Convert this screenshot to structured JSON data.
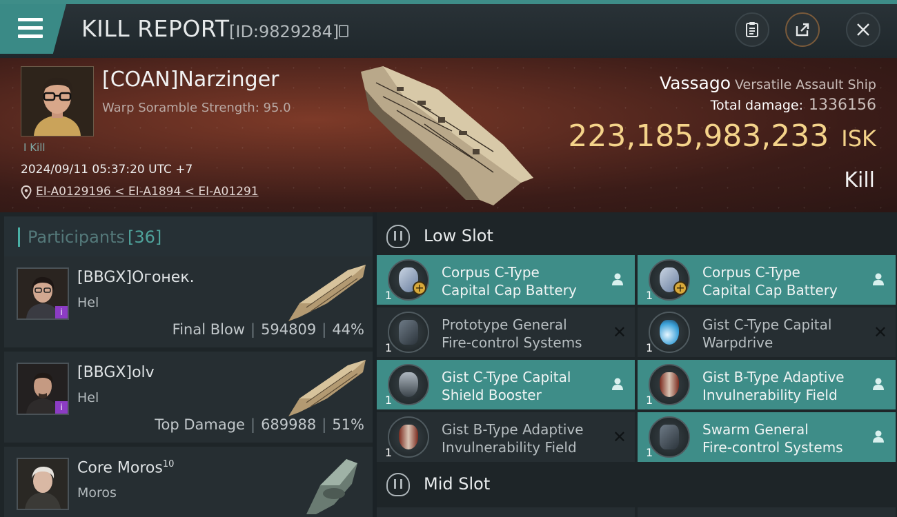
{
  "header": {
    "title": "KILL REPORT",
    "kill_id": "[ID:9829284]"
  },
  "victim": {
    "name": "[COAN]Narzinger",
    "scramble": "Warp Soramble Strength: 95.0",
    "kill_label": "I Kill",
    "timestamp": "2024/09/11 05:37:20 UTC +7",
    "location": "EI-A0129196 < EI-A1894 < EI-A01291"
  },
  "ship": {
    "name": "Vassago",
    "class": "Versatile Assault Ship",
    "total_damage_label": "Total damage:",
    "total_damage": "1336156",
    "isk_value": "223,185,983,233",
    "isk_unit": "ISK",
    "result": "Kill"
  },
  "participants": {
    "label": "Participants",
    "count": "[36]",
    "rows": [
      {
        "name": "[BBGX]Огонек.",
        "ship": "Hel",
        "role": "Final Blow",
        "damage": "594809",
        "percent": "44%",
        "badge": "i"
      },
      {
        "name": "[BBGX]olv",
        "ship": "Hel",
        "role": "Top Damage",
        "damage": "689988",
        "percent": "51%",
        "badge": "i"
      },
      {
        "name": "Core Moros",
        "level": "10",
        "ship": "Moros"
      }
    ]
  },
  "low_slot": {
    "label": "Low Slot",
    "modules": [
      {
        "line1": "Corpus C-Type",
        "line2": "Capital Cap Battery",
        "qty": "1",
        "status": "dropped",
        "icon": "cap-battery-icon"
      },
      {
        "line1": "Corpus C-Type",
        "line2": "Capital Cap Battery",
        "qty": "1",
        "status": "dropped",
        "icon": "cap-battery-icon"
      },
      {
        "line1": "Prototype General",
        "line2": "Fire-control Systems",
        "qty": "1",
        "status": "destroyed",
        "icon": "fire-control-icon"
      },
      {
        "line1": "Gist C-Type Capital",
        "line2": "Warpdrive",
        "qty": "1",
        "status": "destroyed",
        "icon": "warpdrive-icon"
      },
      {
        "line1": "Gist C-Type Capital",
        "line2": "Shield Booster",
        "qty": "1",
        "status": "dropped",
        "icon": "shield-booster-icon"
      },
      {
        "line1": "Gist B-Type Adaptive",
        "line2": "Invulnerability Field",
        "qty": "1",
        "status": "dropped",
        "icon": "invulnerability-icon"
      },
      {
        "line1": "Gist B-Type Adaptive",
        "line2": "Invulnerability Field",
        "qty": "1",
        "status": "destroyed",
        "icon": "invulnerability-icon"
      },
      {
        "line1": "Swarm General",
        "line2": "Fire-control Systems",
        "qty": "1",
        "status": "dropped",
        "icon": "fire-control-icon"
      }
    ]
  },
  "mid_slot": {
    "label": "Mid Slot"
  },
  "colors": {
    "accent": "#3e8d88",
    "isk": "#f4d38a",
    "badge": "#8c3cc4"
  }
}
